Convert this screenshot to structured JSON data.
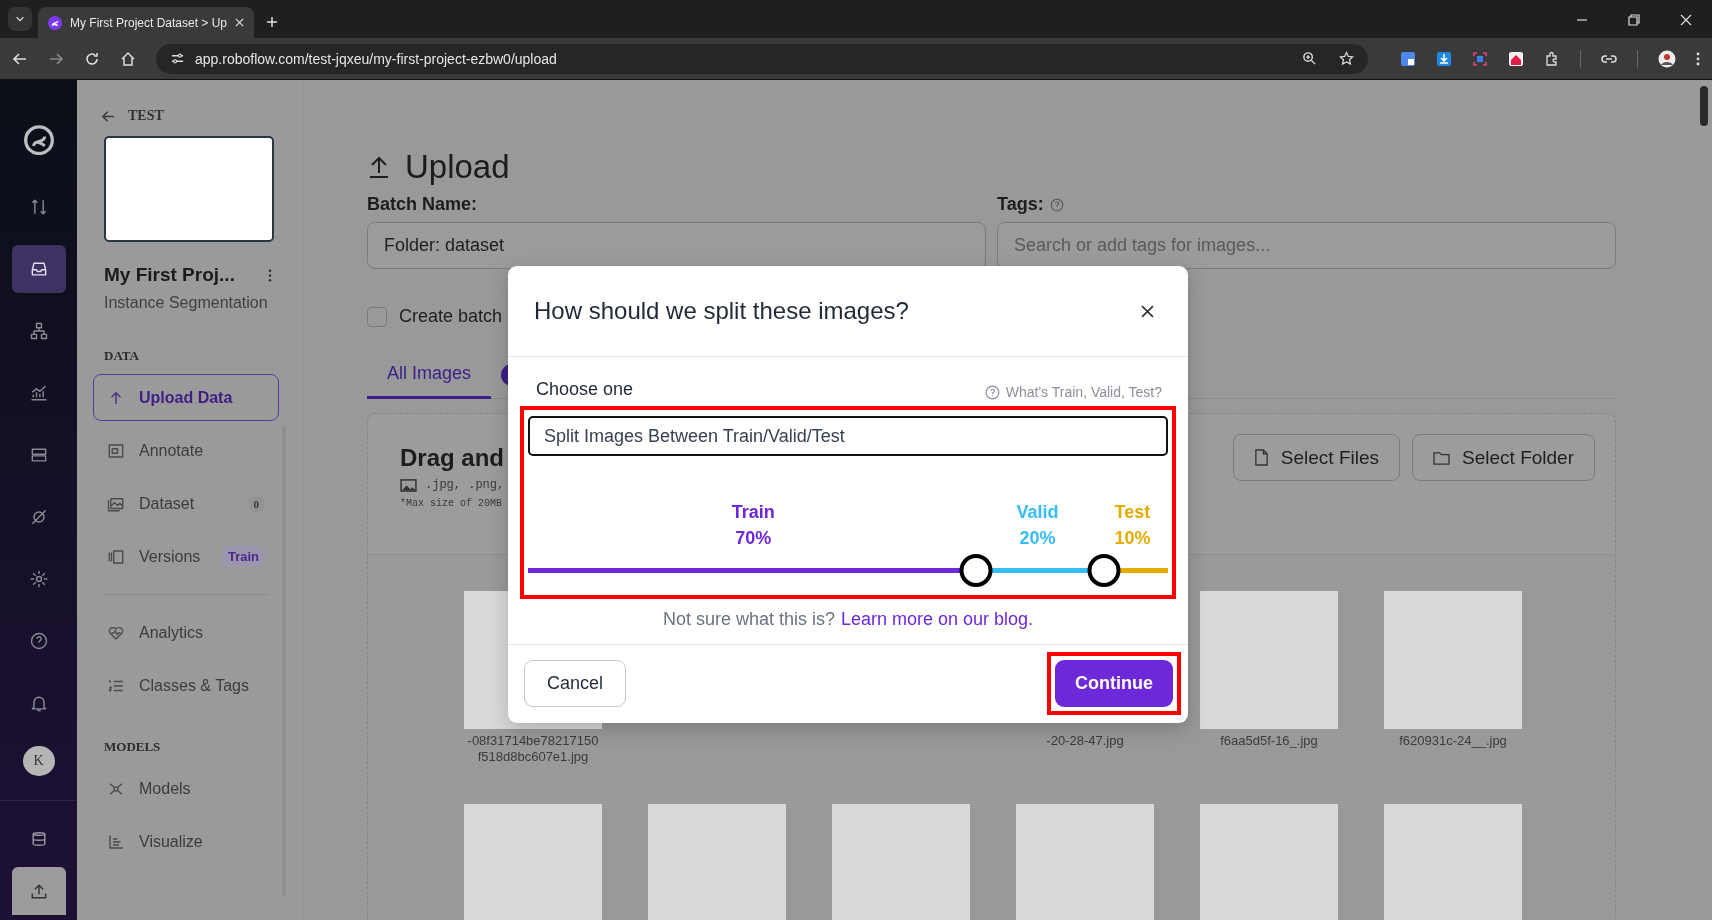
{
  "browser": {
    "tab_title": "My First Project Dataset > Up",
    "url": "app.roboflow.com/test-jqxeu/my-first-project-ezbw0/upload"
  },
  "rail": {
    "items": [
      {
        "kind": "transfer",
        "selected": false
      },
      {
        "kind": "inbox",
        "selected": true
      },
      {
        "kind": "hierarchy",
        "selected": false
      },
      {
        "kind": "chart",
        "selected": false
      },
      {
        "kind": "stack",
        "selected": false
      },
      {
        "kind": "planet",
        "selected": false
      },
      {
        "kind": "gear",
        "selected": false
      },
      {
        "kind": "help",
        "selected": false
      },
      {
        "kind": "bell",
        "selected": false
      }
    ],
    "avatar": "K",
    "bottom_items": [
      {
        "kind": "database"
      },
      {
        "kind": "upload"
      }
    ]
  },
  "sidebar": {
    "back_label": "TEST",
    "project_name": "My First Proj...",
    "project_type": "Instance Segmentation",
    "sections": [
      {
        "heading": "DATA",
        "items": [
          {
            "label": "Upload Data",
            "kind": "upload",
            "selected": true
          },
          {
            "label": "Annotate",
            "kind": "annotate",
            "selected": false
          },
          {
            "label": "Dataset",
            "kind": "dataset",
            "selected": false,
            "count": "0"
          },
          {
            "label": "Versions",
            "kind": "versions",
            "selected": false,
            "tag": "Train"
          }
        ]
      },
      {
        "items": [
          {
            "label": "Analytics",
            "kind": "analytics",
            "selected": false
          },
          {
            "label": "Classes & Tags",
            "kind": "classes",
            "selected": false
          }
        ]
      },
      {
        "heading": "MODELS",
        "items": [
          {
            "label": "Models",
            "kind": "models",
            "selected": false
          },
          {
            "label": "Visualize",
            "kind": "visualize",
            "selected": false
          }
        ]
      }
    ]
  },
  "main": {
    "title": "Upload",
    "batch_label": "Batch Name:",
    "batch_value": "Folder: dataset",
    "tags_label": "Tags:",
    "tags_placeholder": "Search or add tags for images...",
    "create_batch": {
      "label": "Create batch",
      "checked": false
    },
    "tabs": [
      {
        "label": "All Images",
        "selected": true
      }
    ],
    "dropzone": {
      "heading": "Drag and",
      "formats": ".jpg, .png,",
      "max_size": "*Max size of 20MB",
      "buttons": [
        {
          "label": "Select Files",
          "kind": "file"
        },
        {
          "label": "Select Folder",
          "kind": "folder"
        }
      ]
    },
    "images": [
      {
        "kind": "thumbnail",
        "caption": [
          "-08f31714be78217150",
          "f518d8bc607e1.jpg"
        ]
      },
      {
        "kind": "covered"
      },
      {
        "kind": "covered"
      },
      {
        "kind": "covered",
        "caption": [
          "-20-28-47.jpg"
        ]
      },
      {
        "kind": "thumbnail",
        "caption": [
          "f6aa5d5f-16_.jpg"
        ]
      },
      {
        "kind": "thumbnail",
        "caption": [
          "f620931c-24__.jpg"
        ]
      },
      {
        "kind": "thumbnail"
      },
      {
        "kind": "thumbnail"
      },
      {
        "kind": "thumbnail"
      },
      {
        "kind": "thumbnail"
      },
      {
        "kind": "thumbnail"
      },
      {
        "kind": "thumbnail"
      }
    ]
  },
  "modal": {
    "title": "How should we split these images?",
    "choose_label": "Choose one",
    "help_link": "What's Train, Valid, Test?",
    "split_select": "Split Images Between Train/Valid/Test",
    "highlighted": true,
    "segments": [
      {
        "name": "Train",
        "percent": "70%",
        "color": "#6d28d9"
      },
      {
        "name": "Valid",
        "percent": "20%",
        "color": "#38bdf8"
      },
      {
        "name": "Test",
        "percent": "10%",
        "color": "#e5ac00"
      }
    ],
    "handles": [
      {
        "level": 0.7
      },
      {
        "level": 0.9
      }
    ],
    "note": "Not sure what this is?",
    "note_link": "Learn more on our blog.",
    "cancel": "Cancel",
    "continue": "Continue",
    "continue_highlighted": true
  }
}
